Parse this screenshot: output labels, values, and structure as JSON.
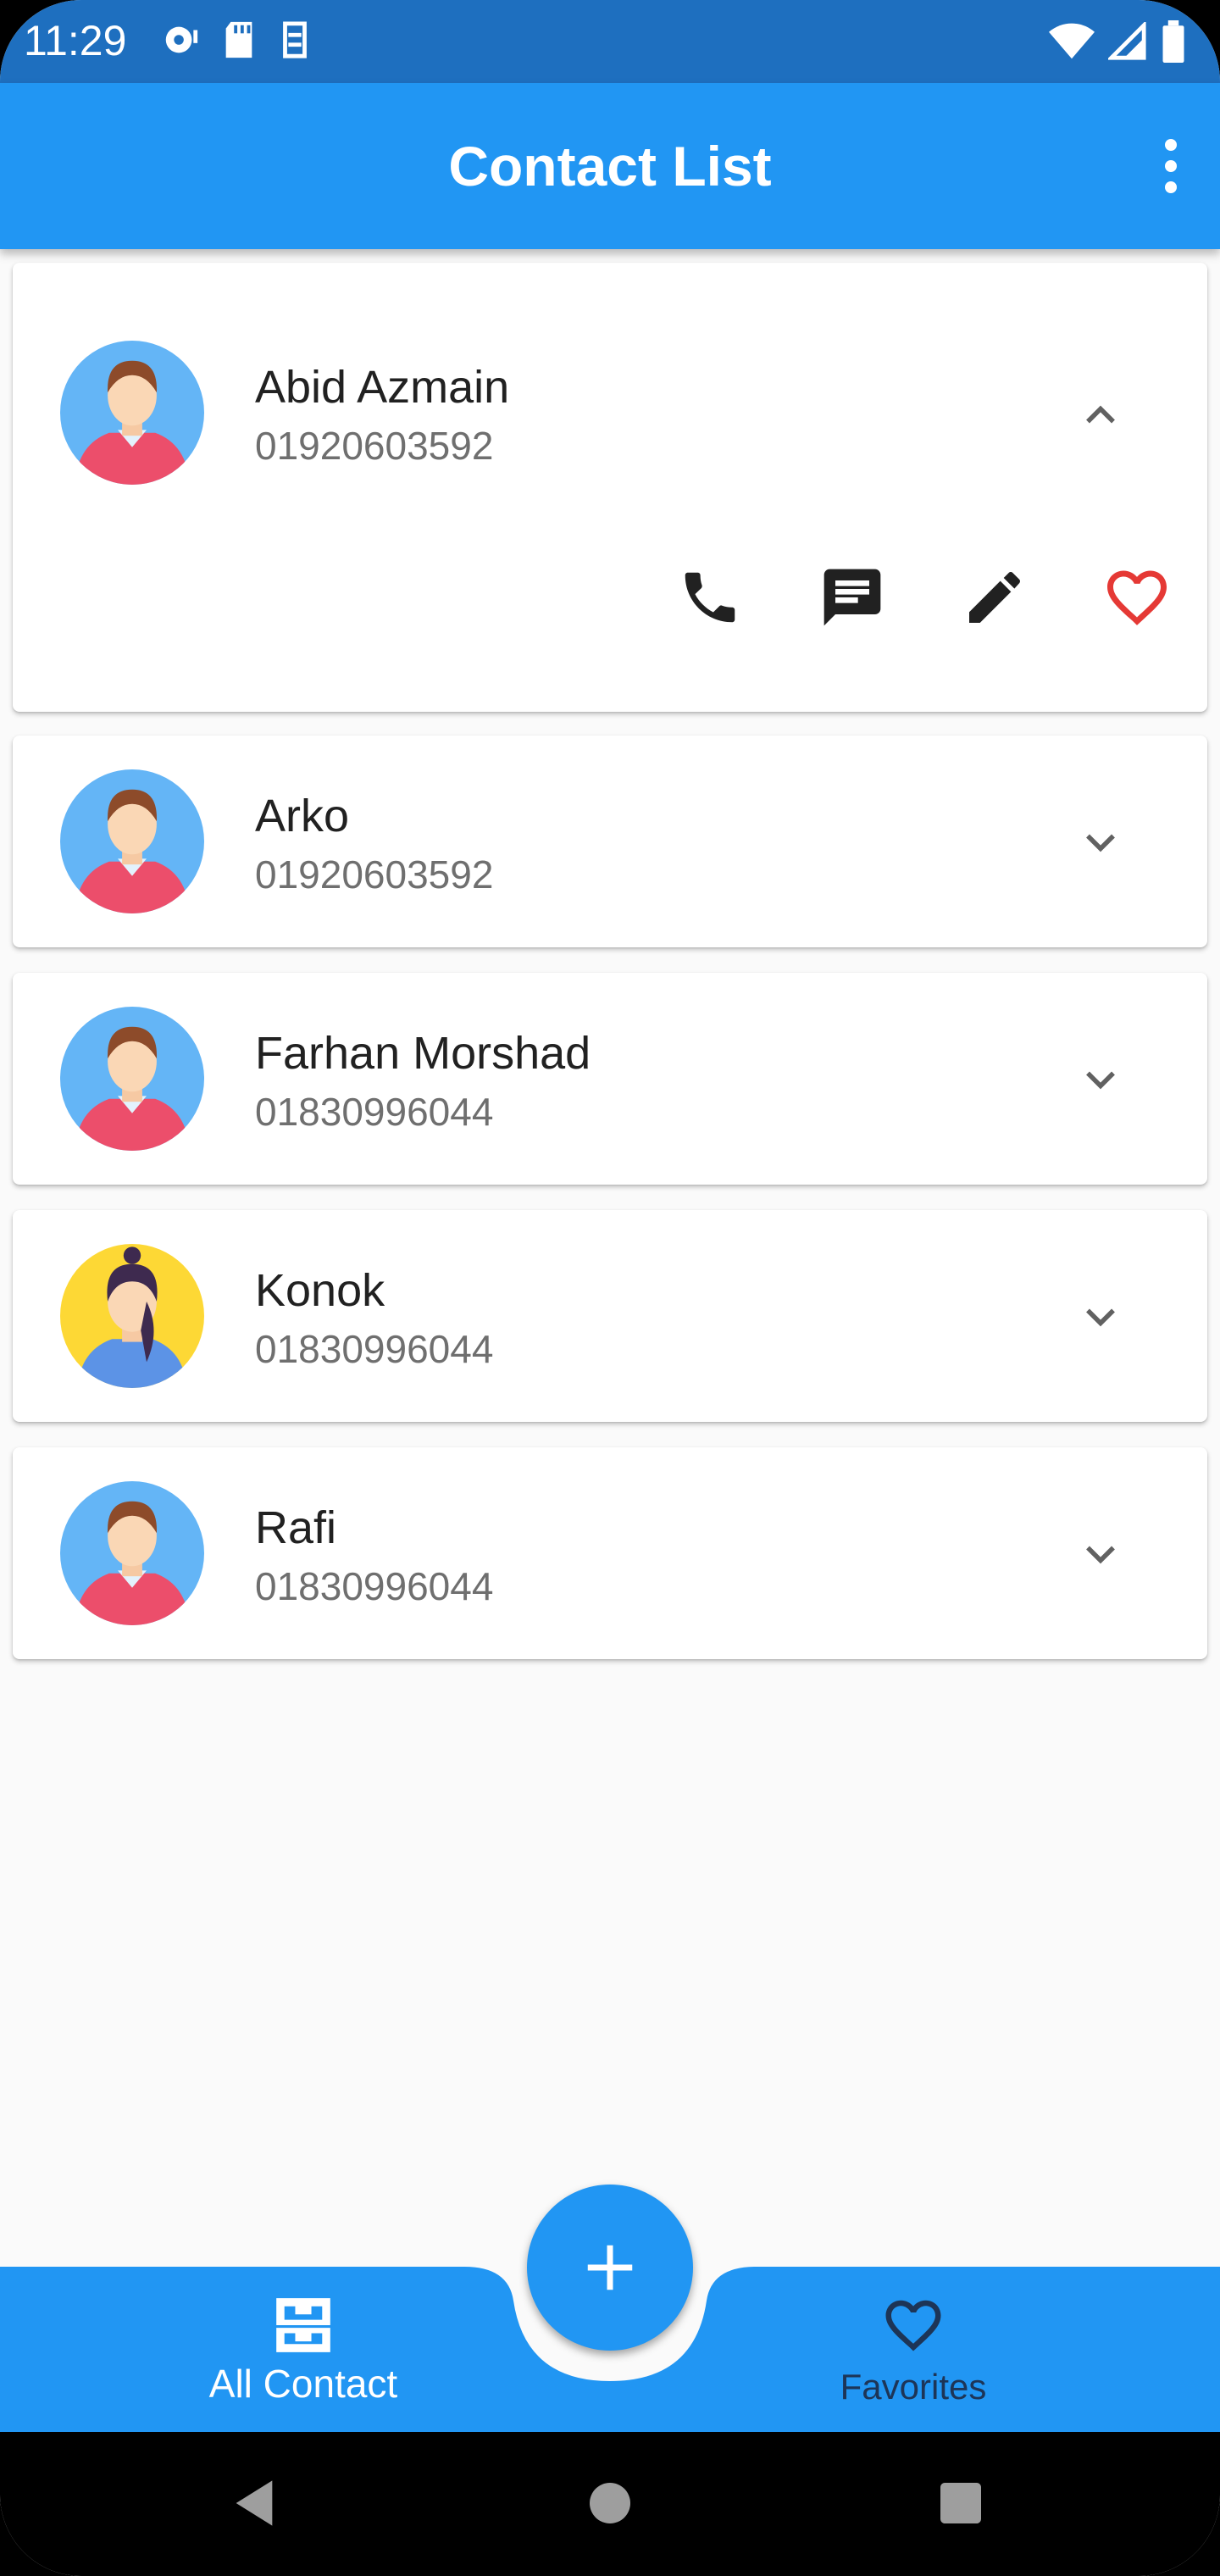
{
  "status_bar": {
    "time": "11:29",
    "left_icons": [
      "media-icon",
      "sd-card-icon",
      "sim-icon"
    ],
    "right_icons": [
      "wifi-icon",
      "signal-icon",
      "battery-icon"
    ]
  },
  "app_bar": {
    "title": "Contact List",
    "menu_icon": "more-vert-icon"
  },
  "contacts": [
    {
      "name": "Abid Azmain",
      "phone": "01920603592",
      "avatar": "male",
      "expanded": true,
      "favorite": false
    },
    {
      "name": "Arko",
      "phone": "01920603592",
      "avatar": "male",
      "expanded": false
    },
    {
      "name": "Farhan Morshad",
      "phone": "01830996044",
      "avatar": "male",
      "expanded": false
    },
    {
      "name": "Konok",
      "phone": "01830996044",
      "avatar": "female",
      "expanded": false
    },
    {
      "name": "Rafi",
      "phone": "01830996044",
      "avatar": "male",
      "expanded": false
    }
  ],
  "expanded_actions": [
    "phone-icon",
    "message-icon",
    "edit-icon",
    "favorite-border-icon"
  ],
  "bottom_nav": {
    "items": [
      {
        "label": "All Contact",
        "icon": "inbox-icon",
        "active": true
      },
      {
        "label": "Favorites",
        "icon": "heart-icon",
        "active": false
      }
    ],
    "fab_icon": "add-icon"
  },
  "colors": {
    "primary": "#2196F3",
    "status_bar": "#1E6FBF",
    "favorite": "#E53935",
    "inactive_nav": "#1D3557"
  }
}
